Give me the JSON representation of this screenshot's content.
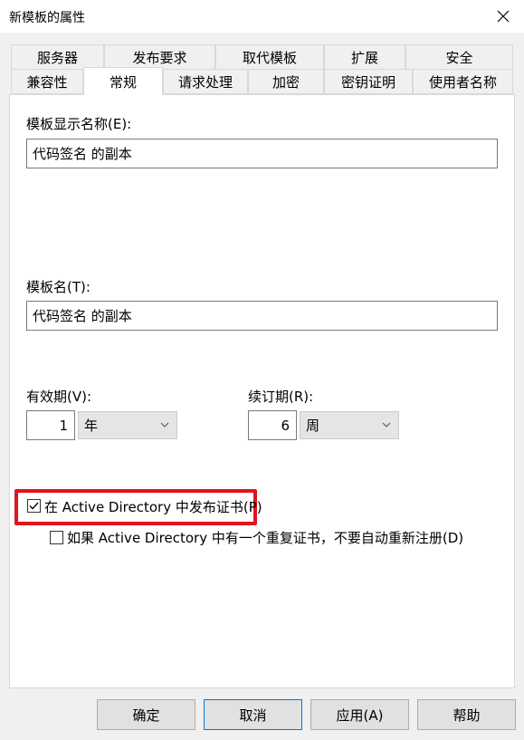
{
  "window": {
    "title": "新模板的属性",
    "close_icon": "close-icon"
  },
  "tabs_row1": [
    "服务器",
    "发布要求",
    "取代模板",
    "扩展",
    "安全"
  ],
  "tabs_row2": [
    "兼容性",
    "常规",
    "请求处理",
    "加密",
    "密钥证明",
    "使用者名称"
  ],
  "selected_tab": "常规",
  "general": {
    "display_name_label": "模板显示名称(E):",
    "display_name_value": "代码签名 的副本",
    "template_name_label": "模板名(T):",
    "template_name_value": "代码签名 的副本",
    "validity_label": "有效期(V):",
    "validity_value": "1",
    "validity_unit": "年",
    "renewal_label": "续订期(R):",
    "renewal_value": "6",
    "renewal_unit": "周",
    "publish_ad_label": "在 Active Directory 中发布证书(P)",
    "publish_ad_checked": true,
    "no_reenroll_label": "如果 Active Directory 中有一个重复证书，不要自动重新注册(D)",
    "no_reenroll_checked": false
  },
  "buttons": {
    "ok": "确定",
    "cancel": "取消",
    "apply": "应用(A)",
    "help": "帮助"
  },
  "colors": {
    "highlight_border": "#e0141e",
    "default_button_border": "#0078d7"
  }
}
